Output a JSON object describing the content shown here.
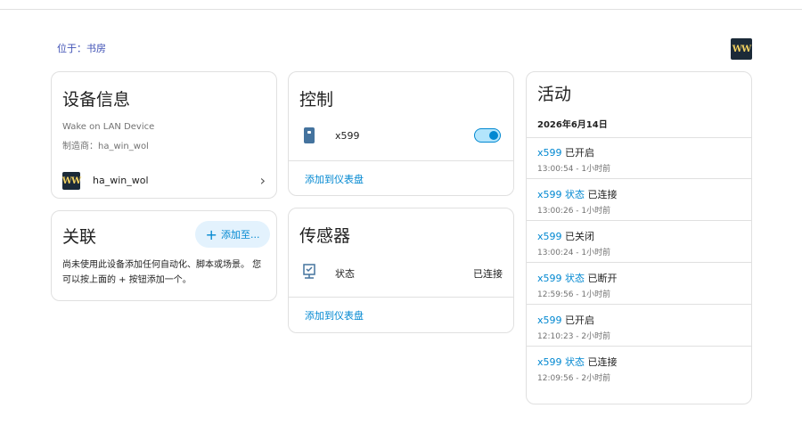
{
  "breadcrumb": "位于：书房",
  "logo": {
    "text": "WW"
  },
  "device_info": {
    "title": "设备信息",
    "model": "Wake on LAN Device",
    "manufacturer": "制造商：ha_win_wol",
    "integration": "ha_win_wol"
  },
  "related": {
    "title": "关联",
    "add_button": "添加至...",
    "empty_text": "尚未使用此设备添加任何自动化、脚本或场景。 您可以按上面的 + 按钮添加一个。"
  },
  "controls": {
    "title": "控制",
    "entity": "x599",
    "add_to_dashboard": "添加到仪表盘"
  },
  "sensors": {
    "title": "传感器",
    "entity": "状态",
    "state": "已连接",
    "add_to_dashboard": "添加到仪表盘"
  },
  "activity": {
    "title": "活动",
    "date": "2026年6月14日",
    "items": [
      {
        "entity": "x599",
        "action": "已开启",
        "time": "13:00:54 - 1小时前"
      },
      {
        "entity": "x599 状态",
        "action": "已连接",
        "time": "13:00:26 - 1小时前"
      },
      {
        "entity": "x599",
        "action": "已关闭",
        "time": "13:00:24 - 1小时前"
      },
      {
        "entity": "x599 状态",
        "action": "已断开",
        "time": "12:59:56 - 1小时前"
      },
      {
        "entity": "x599",
        "action": "已开启",
        "time": "12:10:23 - 2小时前"
      },
      {
        "entity": "x599 状态",
        "action": "已连接",
        "time": "12:09:56 - 2小时前"
      }
    ]
  },
  "colors": {
    "accent": "#0288d1",
    "accent_light": "#e3f2fd"
  },
  "switch_state": "on"
}
